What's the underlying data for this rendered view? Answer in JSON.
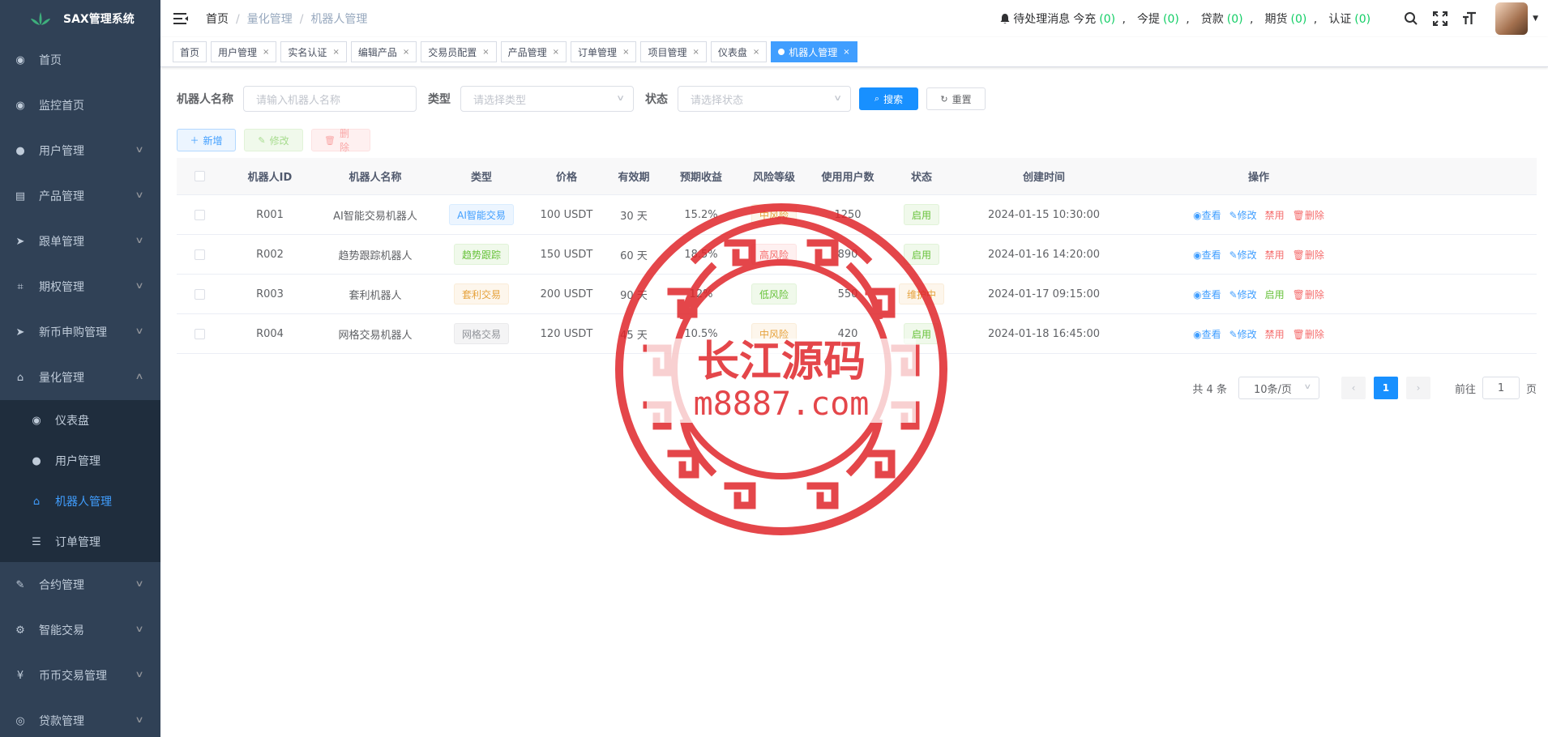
{
  "app": {
    "title": "SAX管理系统"
  },
  "sidebar": {
    "items": [
      {
        "label": "首页",
        "icon": "dashboard-icon",
        "glyph": "◉"
      },
      {
        "label": "监控首页",
        "icon": "dashboard-icon",
        "glyph": "◉"
      },
      {
        "label": "用户管理",
        "icon": "user-icon",
        "glyph": "●",
        "expandable": true
      },
      {
        "label": "产品管理",
        "icon": "document-icon",
        "glyph": "▤",
        "expandable": true
      },
      {
        "label": "跟单管理",
        "icon": "send-icon",
        "glyph": "➤",
        "expandable": true
      },
      {
        "label": "期权管理",
        "icon": "chart-icon",
        "glyph": "⌗",
        "expandable": true
      },
      {
        "label": "新币申购管理",
        "icon": "send-icon",
        "glyph": "➤",
        "expandable": true
      },
      {
        "label": "量化管理",
        "icon": "robot-icon",
        "glyph": "⌂",
        "expandable": true,
        "open": true
      }
    ],
    "subitems": [
      {
        "label": "仪表盘",
        "icon": "dashboard-icon",
        "glyph": "◉"
      },
      {
        "label": "用户管理",
        "icon": "user-icon",
        "glyph": "●"
      },
      {
        "label": "机器人管理",
        "icon": "robot-icon",
        "glyph": "⌂",
        "active": true
      },
      {
        "label": "订单管理",
        "icon": "list-icon",
        "glyph": "☰"
      }
    ],
    "items_after": [
      {
        "label": "合约管理",
        "icon": "edit-icon",
        "glyph": "✎",
        "expandable": true
      },
      {
        "label": "智能交易",
        "icon": "gear-icon",
        "glyph": "⚙",
        "expandable": true
      },
      {
        "label": "币币交易管理",
        "icon": "yen-icon",
        "glyph": "¥",
        "expandable": true
      },
      {
        "label": "贷款管理",
        "icon": "money-icon",
        "glyph": "◎",
        "expandable": true
      }
    ]
  },
  "header": {
    "breadcrumb": [
      "首页",
      "量化管理",
      "机器人管理"
    ],
    "notice": {
      "label": "待处理消息",
      "items": [
        {
          "label": "今充",
          "count": "(0)"
        },
        {
          "label": "今提",
          "count": "(0)"
        },
        {
          "label": "贷款",
          "count": "(0)"
        },
        {
          "label": "期货",
          "count": "(0)"
        },
        {
          "label": "认证",
          "count": "(0)"
        }
      ]
    }
  },
  "tabs": [
    {
      "label": "首页",
      "closable": false
    },
    {
      "label": "用户管理",
      "closable": true
    },
    {
      "label": "实名认证",
      "closable": true
    },
    {
      "label": "编辑产品",
      "closable": true
    },
    {
      "label": "交易员配置",
      "closable": true
    },
    {
      "label": "产品管理",
      "closable": true
    },
    {
      "label": "订单管理",
      "closable": true
    },
    {
      "label": "项目管理",
      "closable": true
    },
    {
      "label": "仪表盘",
      "closable": true
    },
    {
      "label": "机器人管理",
      "closable": true,
      "active": true
    }
  ],
  "search": {
    "name_label": "机器人名称",
    "name_placeholder": "请输入机器人名称",
    "type_label": "类型",
    "type_placeholder": "请选择类型",
    "status_label": "状态",
    "status_placeholder": "请选择状态",
    "search_btn": "搜索",
    "reset_btn": "重置"
  },
  "toolbar": {
    "add": "新增",
    "edit": "修改",
    "delete": "删除"
  },
  "table": {
    "columns": [
      "机器人ID",
      "机器人名称",
      "类型",
      "价格",
      "有效期",
      "预期收益",
      "风险等级",
      "使用用户数",
      "状态",
      "创建时间",
      "操作"
    ],
    "rows": [
      {
        "id": "R001",
        "name": "AI智能交易机器人",
        "type": "AI智能交易",
        "type_style": "blue",
        "price": "100 USDT",
        "validity": "30 天",
        "return": "15.2%",
        "risk": "中风险",
        "risk_style": "orange",
        "users": "1250",
        "status": "启用",
        "status_style": "green",
        "created": "2024-01-15 10:30:00",
        "toggle": "禁用"
      },
      {
        "id": "R002",
        "name": "趋势跟踪机器人",
        "type": "趋势跟踪",
        "type_style": "green",
        "price": "150 USDT",
        "validity": "60 天",
        "return": "18.5%",
        "risk": "高风险",
        "risk_style": "red",
        "users": "890",
        "status": "启用",
        "status_style": "green",
        "created": "2024-01-16 14:20:00",
        "toggle": "禁用"
      },
      {
        "id": "R003",
        "name": "套利机器人",
        "type": "套利交易",
        "type_style": "orange",
        "price": "200 USDT",
        "validity": "90 天",
        "return": "12%",
        "risk": "低风险",
        "risk_style": "green",
        "users": "550",
        "status": "维护中",
        "status_style": "orange",
        "created": "2024-01-17 09:15:00",
        "toggle": "启用"
      },
      {
        "id": "R004",
        "name": "网格交易机器人",
        "type": "网格交易",
        "type_style": "gray",
        "price": "120 USDT",
        "validity": "45 天",
        "return": "10.5%",
        "risk": "中风险",
        "risk_style": "orange",
        "users": "420",
        "status": "启用",
        "status_style": "green",
        "created": "2024-01-18 16:45:00",
        "toggle": "禁用"
      }
    ],
    "ops": {
      "view": "查看",
      "edit": "修改",
      "delete": "删除"
    }
  },
  "pagination": {
    "total": "共 4 条",
    "page_size": "10条/页",
    "current": "1",
    "goto_label": "前往",
    "goto_value": "1",
    "page_suffix": "页"
  },
  "watermark": {
    "line1": "长江源码",
    "line2": "m8887.com"
  },
  "colors": {
    "sidebar_bg": "#304156",
    "submenu_bg": "#1f2d3d",
    "primary": "#1890ff",
    "stamp": "#e0262b"
  }
}
